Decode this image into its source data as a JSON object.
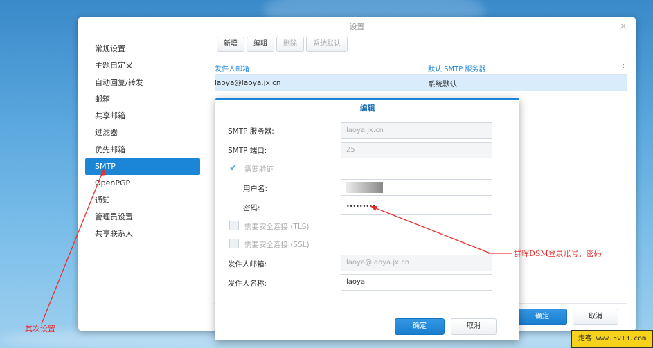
{
  "window": {
    "title": "设置",
    "close": "×"
  },
  "sidebar": {
    "items": [
      {
        "label": "常规设置"
      },
      {
        "label": "主题自定义"
      },
      {
        "label": "自动回复/转发"
      },
      {
        "label": "邮箱"
      },
      {
        "label": "共享邮箱"
      },
      {
        "label": "过滤器"
      },
      {
        "label": "优先邮箱"
      },
      {
        "label": "SMTP",
        "active": true
      },
      {
        "label": "OpenPGP"
      },
      {
        "label": "通知"
      },
      {
        "label": "管理员设置"
      },
      {
        "label": "共享联系人"
      }
    ]
  },
  "toolbar": {
    "add": "新增",
    "edit": "编辑",
    "delete": "删除",
    "default": "系统默认"
  },
  "grid": {
    "columns": [
      "发件人邮箱",
      "默认 SMTP 服务器",
      "⁝"
    ],
    "rows": [
      {
        "sender": "laoya@laoya.jx.cn",
        "server": "系统默认"
      }
    ]
  },
  "footer": {
    "ok": "确定",
    "cancel": "取消"
  },
  "dialog": {
    "title": "编辑",
    "smtp_server_label": "SMTP 服务器:",
    "smtp_server_value": "laoya.jx.cn",
    "smtp_port_label": "SMTP 端口:",
    "smtp_port_value": "25",
    "require_auth_label": "需要验证",
    "require_auth_checked": true,
    "username_label": "用户名:",
    "password_label": "密码:",
    "password_value": "•••••••••",
    "tls_label": "需要安全连接 (TLS)",
    "ssl_label": "需要安全连接 (SSL)",
    "sender_email_label": "发件人邮箱:",
    "sender_email_value": "laoya@laoya.jx.cn",
    "sender_name_label": "发件人名称:",
    "sender_name_value": "laoya",
    "ok": "确定",
    "cancel": "取消"
  },
  "annotations": {
    "left_note": "其次设置",
    "right_note": "群晖DSM登录账号、密码",
    "color": "#e53030"
  },
  "watermark": {
    "text": "走客 www.5v13.com"
  }
}
